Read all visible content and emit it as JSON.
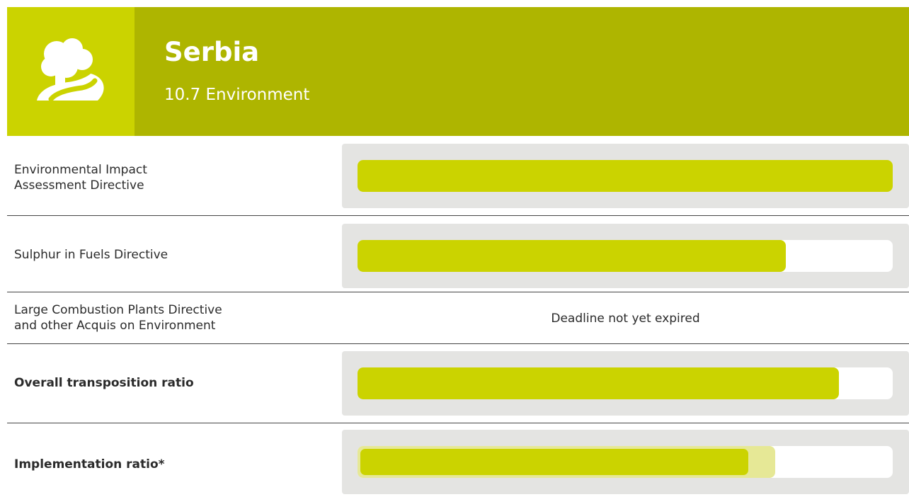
{
  "header": {
    "country": "Serbia",
    "chapter": "10.7 Environment",
    "icon": "tree-path-icon",
    "colors": {
      "icon_panel": "#cbd300",
      "title_panel": "#aeb500",
      "bar_fill": "#cbd300",
      "bar_fill_light": "#e6e896",
      "track": "#e4e4e2"
    }
  },
  "rows": [
    {
      "label_line1": "Environmental Impact",
      "label_line2": "Assessment Directive",
      "ratio": 1.0
    },
    {
      "label": "Sulphur in Fuels Directive",
      "ratio": 0.8
    },
    {
      "label_line1": "Large Combustion Plants Directive",
      "label_line2": "and other Acquis on Environment",
      "status": "Deadline not yet expired"
    },
    {
      "label": "Overall transposition ratio",
      "ratio": 0.9
    },
    {
      "label": "Implementation ratio*",
      "ratio": 0.73,
      "ratio_light": 0.78
    }
  ]
}
